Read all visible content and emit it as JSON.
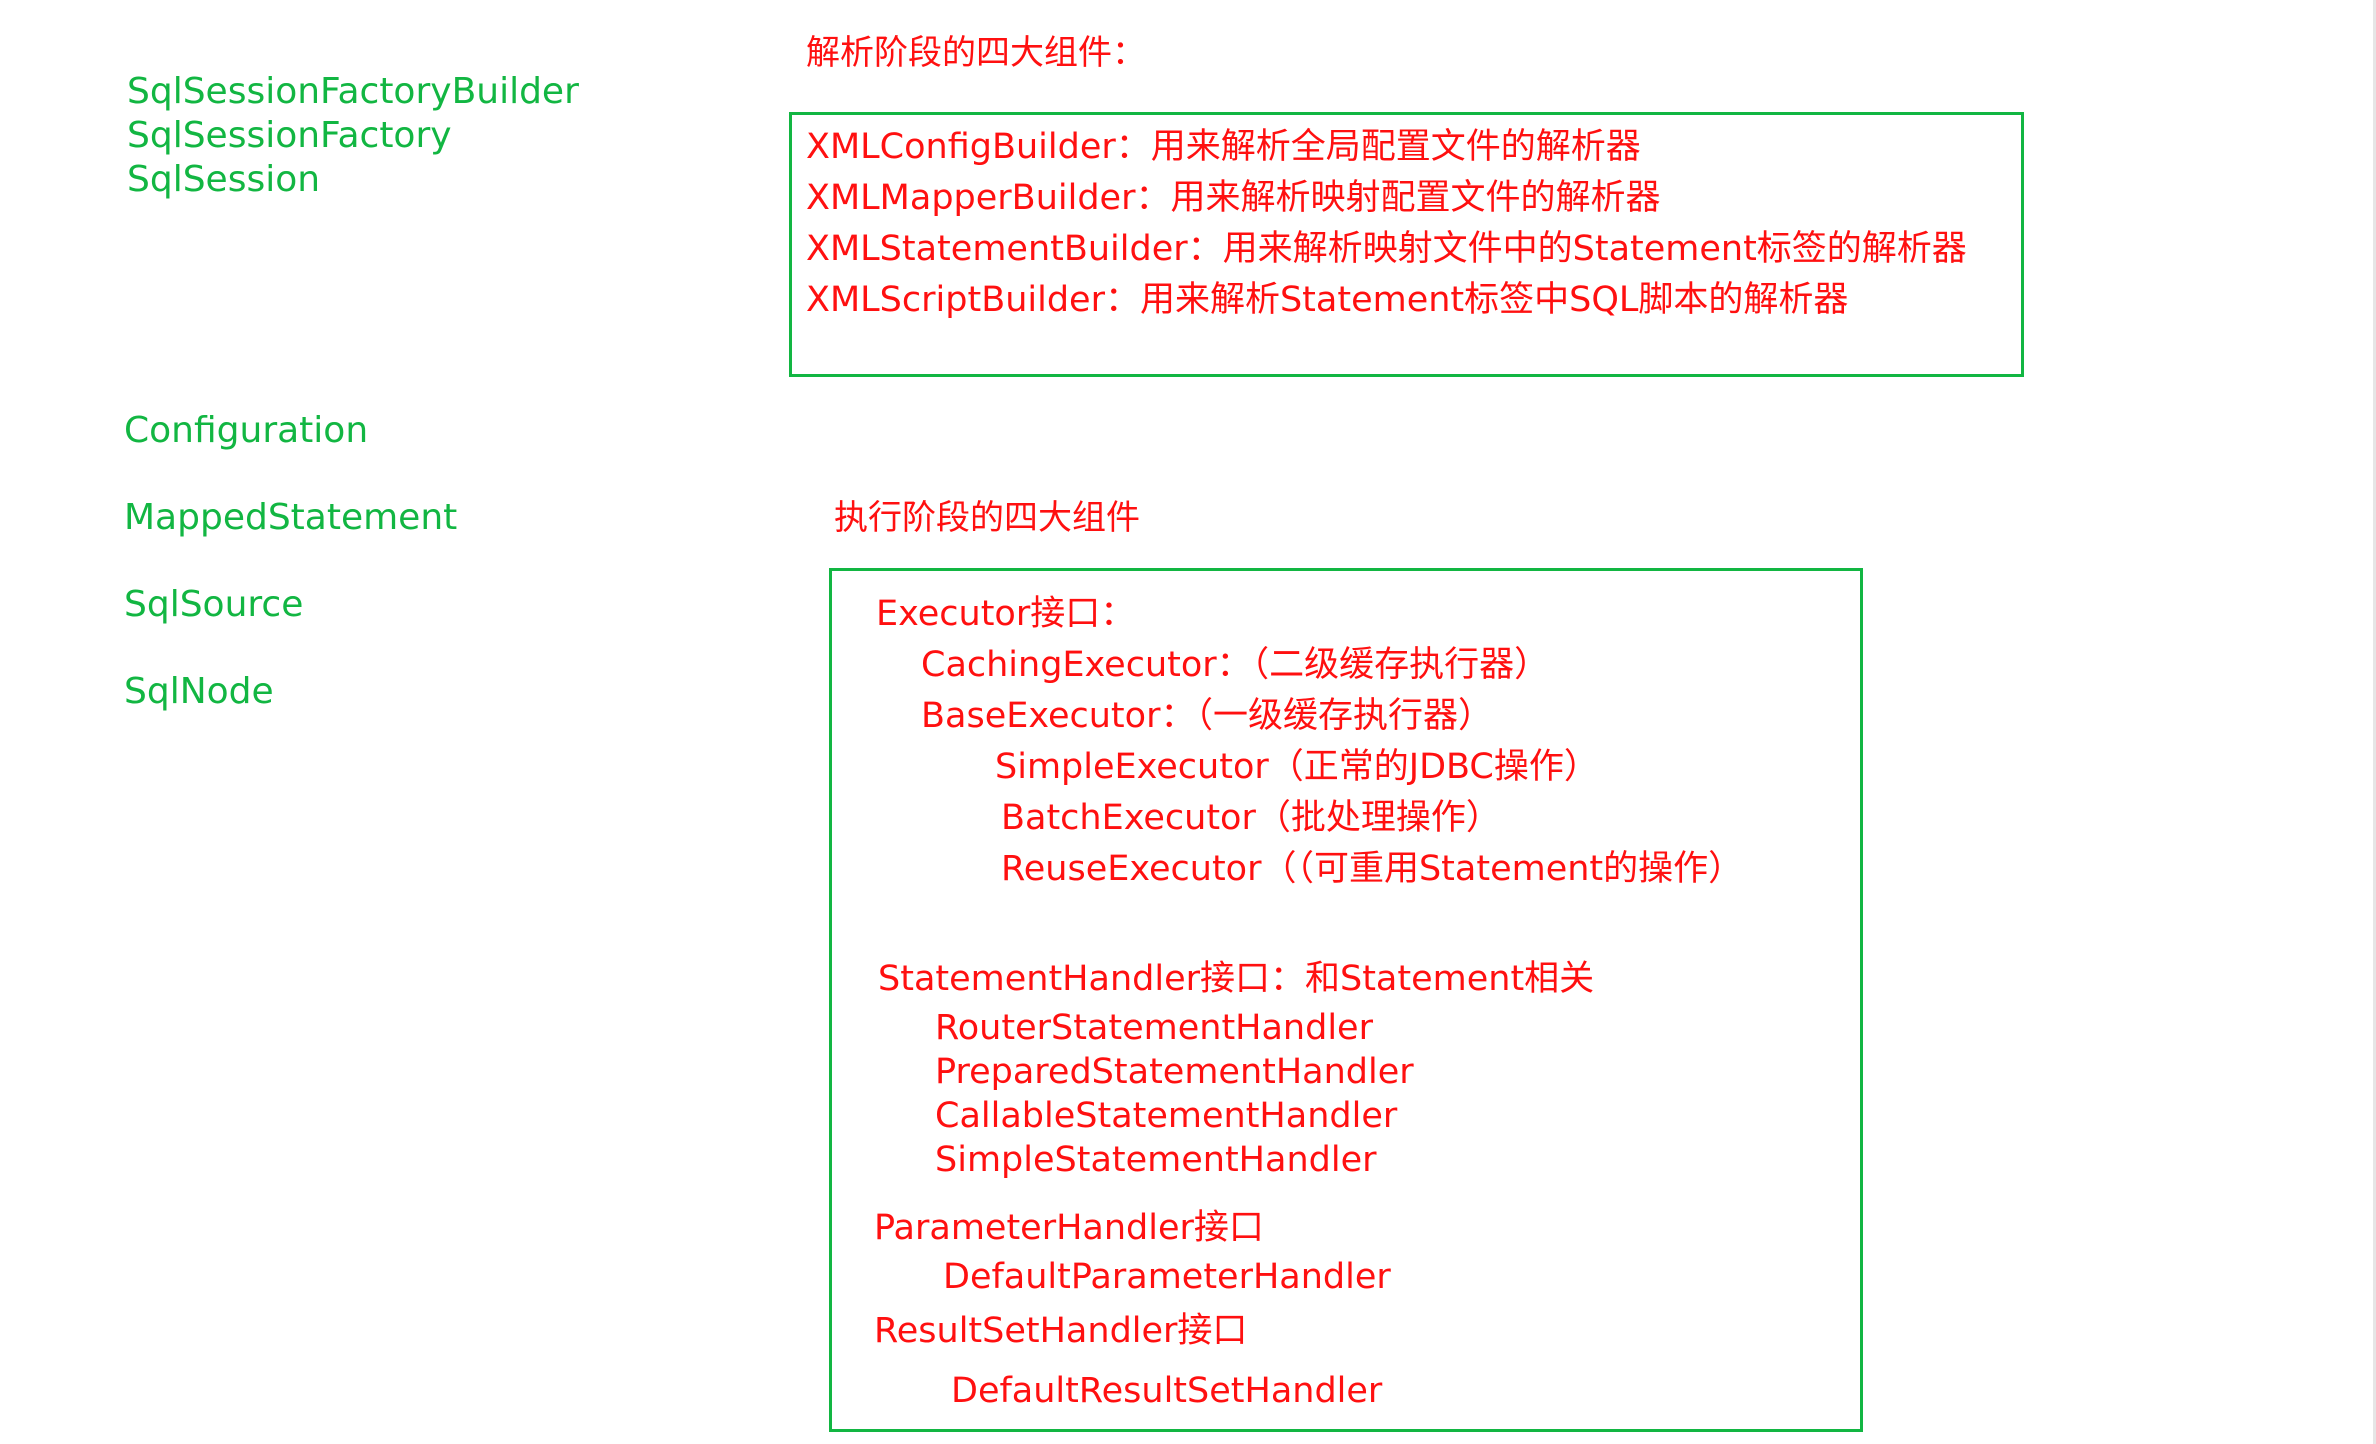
{
  "left_terms": {
    "factory_builder": "SqlSessionFactoryBuilder",
    "factory": "SqlSessionFactory",
    "session": "SqlSession",
    "configuration": "Configuration",
    "mapped_statement": "MappedStatement",
    "sql_source": "SqlSource",
    "sql_node": "SqlNode"
  },
  "parse_phase": {
    "title": "解析阶段的四大组件：",
    "items": [
      "XMLConfigBuilder：用来解析全局配置文件的解析器",
      "XMLMapperBuilder：用来解析映射配置文件的解析器",
      "XMLStatementBuilder：用来解析映射文件中的Statement标签的解析器",
      "XMLScriptBuilder：用来解析Statement标签中SQL脚本的解析器"
    ]
  },
  "execute_phase": {
    "title": "执行阶段的四大组件",
    "executor": {
      "label": "Executor接口：",
      "caching": "CachingExecutor：（二级缓存执行器）",
      "base": "BaseExecutor：（一级缓存执行器）",
      "simple": "SimpleExecutor（正常的JDBC操作）",
      "batch": "BatchExecutor（批处理操作）",
      "reuse": "ReuseExecutor（（可重用Statement的操作）"
    },
    "statement_handler": {
      "label": "StatementHandler接口：和Statement相关",
      "items": [
        "RouterStatementHandler",
        "PreparedStatementHandler",
        "CallableStatementHandler",
        "SimpleStatementHandler"
      ]
    },
    "parameter_handler": {
      "label": "ParameterHandler接口",
      "default": "DefaultParameterHandler"
    },
    "resultset_handler": {
      "label": "ResultSetHandler接口",
      "default": "DefaultResultSetHandler"
    }
  },
  "colors": {
    "green": "#12b642",
    "red": "#ff1010",
    "background": "#ffffff"
  }
}
